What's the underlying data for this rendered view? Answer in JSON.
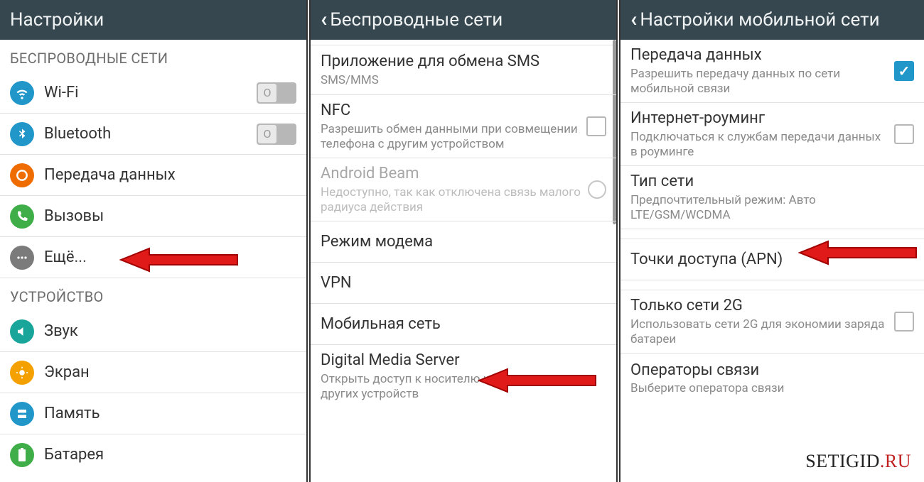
{
  "panel1": {
    "header": "Настройки",
    "sections": {
      "wireless_header": "БЕСПРОВОДНЫЕ СЕТИ",
      "device_header": "УСТРОЙСТВО"
    },
    "items": {
      "wifi": "Wi-Fi",
      "bluetooth": "Bluetooth",
      "data": "Передача данных",
      "calls": "Вызовы",
      "more": "Ещё...",
      "sound": "Звук",
      "screen": "Экран",
      "storage": "Память",
      "battery": "Батарея"
    }
  },
  "panel2": {
    "header": "Беспроводные сети",
    "items": {
      "sms_title": "Приложение для обмена SMS",
      "sms_sub": "SMS/MMS",
      "nfc_title": "NFC",
      "nfc_sub": "Разрешить обмен данными при совмещении телефона с другим устройством",
      "beam_title": "Android Beam",
      "beam_sub": "Недоступно, так как отключена связь малого радиуса действия",
      "tether": "Режим модема",
      "vpn": "VPN",
      "mobile": "Мобильная сеть",
      "dms_title": "Digital Media Server",
      "dms_sub": "Открыть доступ к носителю информации для других устройств"
    }
  },
  "panel3": {
    "header": "Настройки мобильной сети",
    "items": {
      "data_title": "Передача данных",
      "data_sub": "Разрешить передачу данных по сети мобильной связи",
      "roam_title": "Интернет-роуминг",
      "roam_sub": "Подключаться к службам передачи данных в роуминге",
      "type_title": "Тип сети",
      "type_sub": "Предпочтительный режим: Авто LTE/GSM/WCDMA",
      "apn_title": "Точки доступа (APN)",
      "g2_title": "Только сети 2G",
      "g2_sub": "Использовать сети 2G для экономии заряда батареи",
      "ops_title": "Операторы связи",
      "ops_sub": "Выберите оператора связи"
    }
  },
  "watermark": {
    "a": "SETIGID",
    "b": ".RU"
  },
  "icons": {
    "wifi": "wifi-icon",
    "bt": "bluetooth-icon",
    "data": "data-usage-icon",
    "call": "phone-icon",
    "more": "more-icon",
    "sound": "sound-icon",
    "screen": "brightness-icon",
    "storage": "storage-icon",
    "battery": "battery-icon"
  }
}
